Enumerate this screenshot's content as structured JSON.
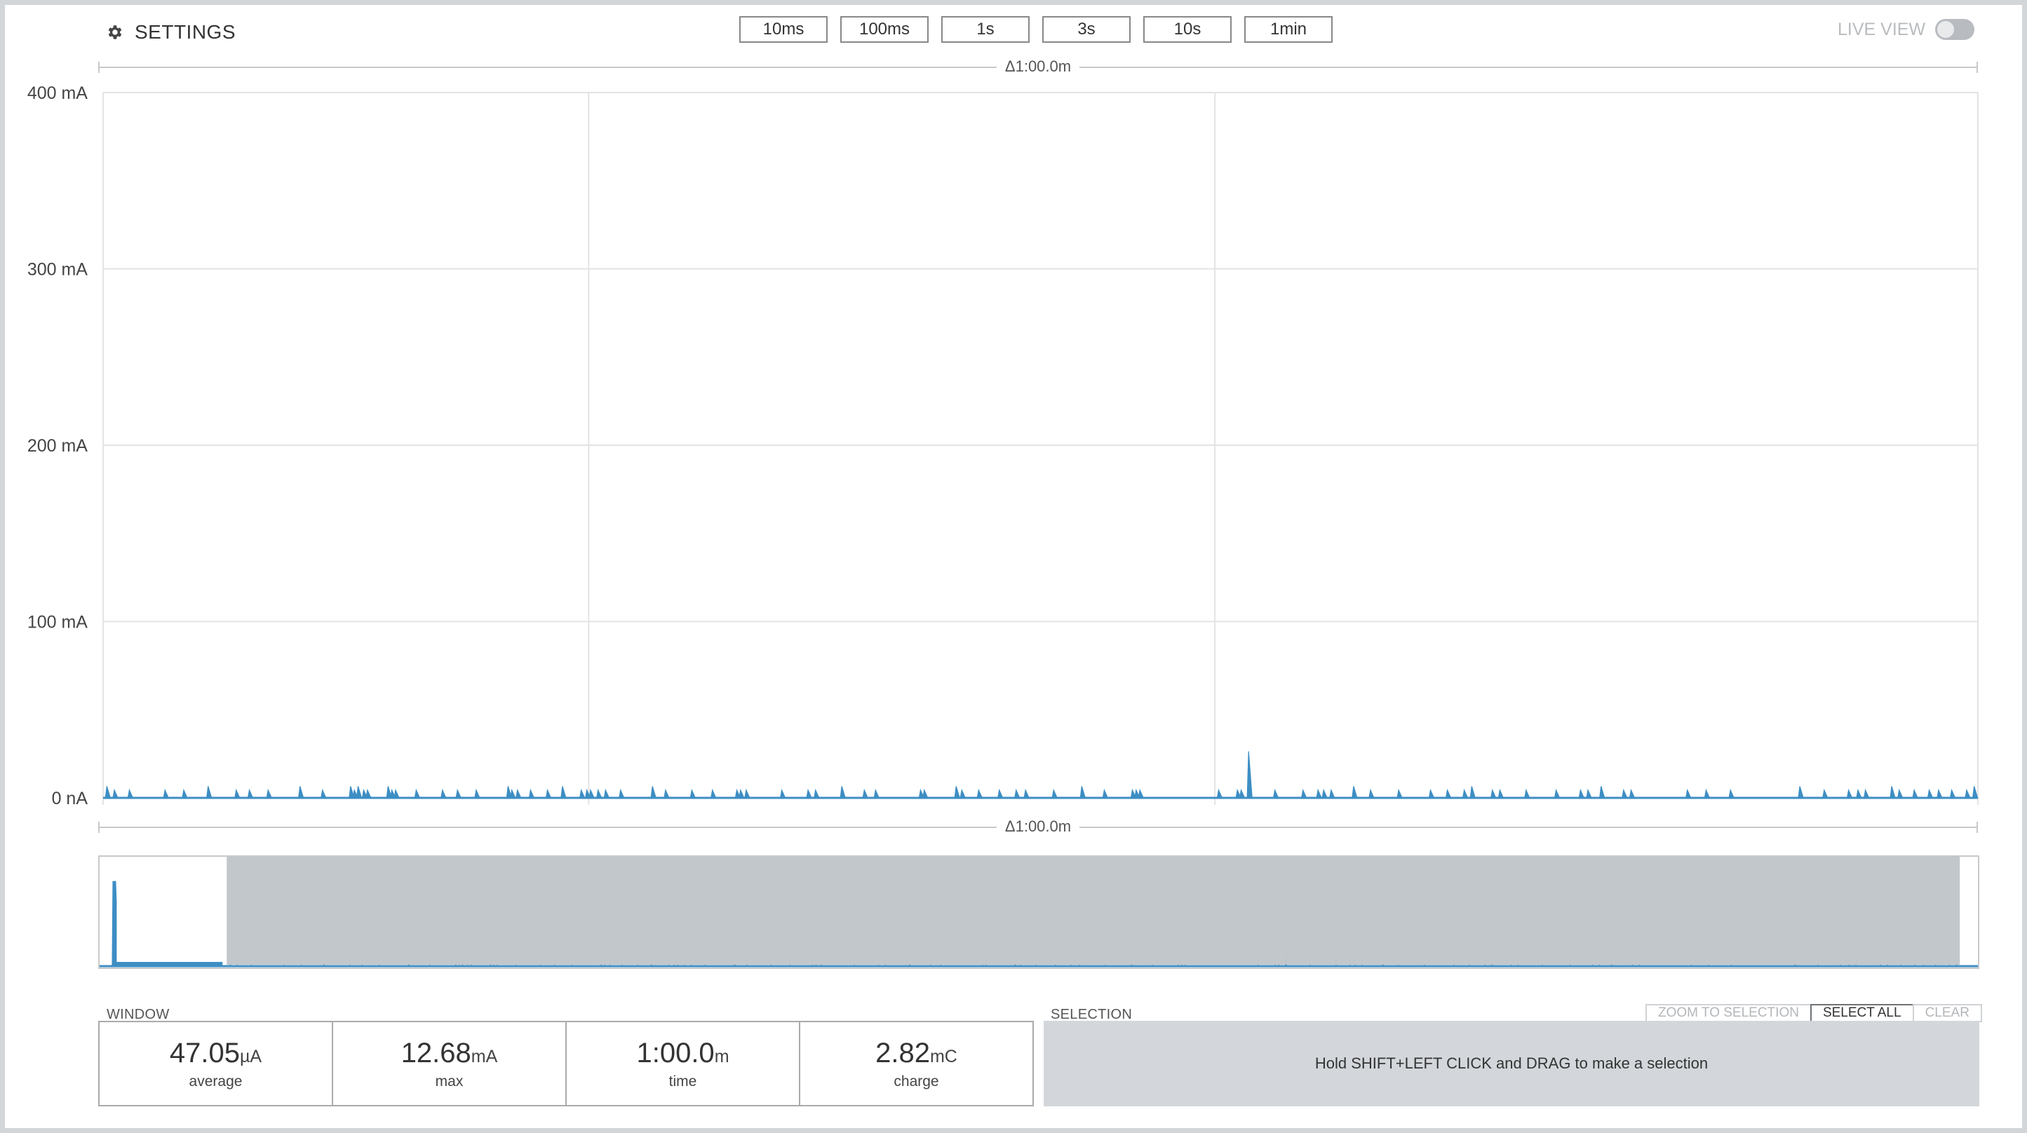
{
  "header": {
    "settings_label": "SETTINGS",
    "zoom_buttons": [
      "10ms",
      "100ms",
      "1s",
      "3s",
      "10s",
      "1min"
    ],
    "live_view_label": "LIVE VIEW",
    "live_view_on": false
  },
  "chart_data": {
    "type": "line",
    "y_ticks": [
      "400 mA",
      "300 mA",
      "200 mA",
      "100 mA",
      "0 nA"
    ],
    "ylim": [
      0,
      400
    ],
    "y_unit": "mA",
    "delta_label_top": "Δ1:00.0m",
    "delta_label_bottom": "Δ1:00.0m",
    "grid": true,
    "series_color": "#3d8ec4",
    "spike_x": [
      0.002,
      0.006,
      0.014,
      0.033,
      0.043,
      0.056,
      0.071,
      0.078,
      0.088,
      0.105,
      0.117,
      0.132,
      0.134,
      0.136,
      0.139,
      0.141,
      0.152,
      0.154,
      0.156,
      0.167,
      0.181,
      0.189,
      0.199,
      0.216,
      0.218,
      0.221,
      0.228,
      0.237,
      0.245,
      0.255,
      0.258,
      0.26,
      0.264,
      0.268,
      0.276,
      0.293,
      0.3,
      0.314,
      0.325,
      0.338,
      0.34,
      0.343,
      0.362,
      0.376,
      0.38,
      0.394,
      0.406,
      0.412,
      0.436,
      0.438,
      0.455,
      0.458,
      0.467,
      0.478,
      0.487,
      0.492,
      0.507,
      0.522,
      0.534,
      0.549,
      0.551,
      0.553,
      0.595,
      0.605,
      0.611,
      0.607,
      0.625,
      0.64,
      0.648,
      0.651,
      0.655,
      0.667,
      0.676,
      0.691,
      0.708,
      0.717,
      0.726,
      0.73,
      0.741,
      0.745,
      0.759,
      0.775,
      0.788,
      0.792,
      0.799,
      0.811,
      0.815,
      0.845,
      0.855,
      0.868,
      0.905,
      0.918,
      0.931,
      0.936,
      0.94,
      0.954,
      0.958,
      0.966,
      0.974,
      0.979,
      0.986,
      0.994,
      0.998
    ],
    "spike_ma": [
      3,
      2,
      2,
      2,
      2,
      3,
      2,
      2,
      2,
      3,
      2,
      3,
      2,
      3,
      2,
      2,
      3,
      2,
      2,
      2,
      2,
      2,
      2,
      3,
      2,
      2,
      2,
      2,
      3,
      2,
      2,
      2,
      2,
      2,
      2,
      3,
      2,
      2,
      2,
      2,
      2,
      2,
      2,
      2,
      2,
      3,
      2,
      2,
      2,
      2,
      3,
      2,
      2,
      2,
      2,
      2,
      2,
      3,
      2,
      2,
      2,
      2,
      2,
      2,
      12,
      2,
      2,
      2,
      2,
      2,
      2,
      3,
      2,
      2,
      2,
      2,
      2,
      3,
      2,
      2,
      2,
      2,
      2,
      2,
      3,
      2,
      2,
      2,
      2,
      2,
      3,
      2,
      2,
      2,
      2,
      3,
      2,
      2,
      2,
      2,
      2,
      2,
      3
    ],
    "overview": {
      "view_start": 0.068,
      "view_end": 0.99,
      "peak_x": 0.008,
      "peak_level": 0.82
    }
  },
  "window": {
    "label": "WINDOW",
    "stats": [
      {
        "value": "47.05",
        "unit": "µA",
        "caption": "average"
      },
      {
        "value": "12.68",
        "unit": "mA",
        "caption": "max"
      },
      {
        "value": "1:00.0",
        "unit": "m",
        "caption": "time"
      },
      {
        "value": "2.82",
        "unit": "mC",
        "caption": "charge"
      }
    ]
  },
  "selection": {
    "label": "SELECTION",
    "buttons": [
      "ZOOM TO SELECTION",
      "SELECT ALL",
      "CLEAR"
    ],
    "active_button": "SELECT ALL",
    "hint": "Hold SHIFT+LEFT CLICK and DRAG to make a selection"
  },
  "colors": {
    "grid": "#e3e3e3",
    "trace": "#3d8ec4",
    "overview_mask": "#bfc4c9"
  }
}
